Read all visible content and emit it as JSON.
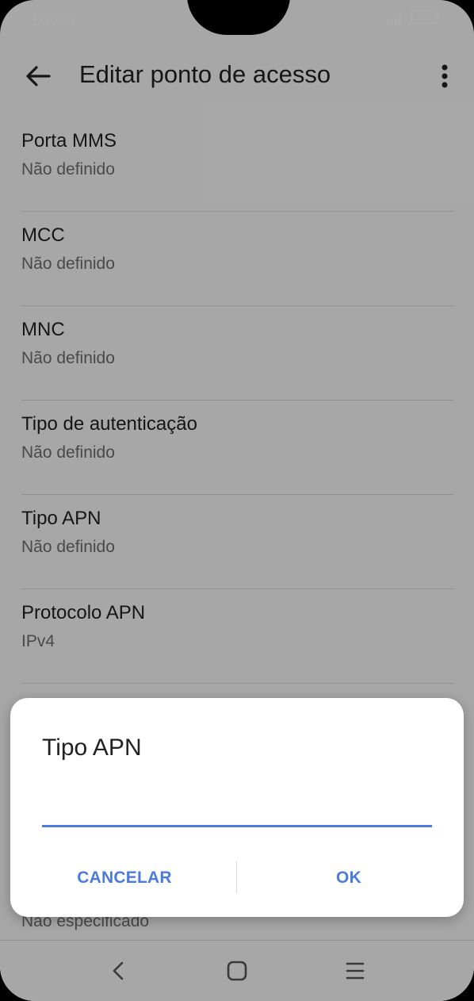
{
  "status_bar": {
    "time": "10:00",
    "battery": "100"
  },
  "app_bar": {
    "title": "Editar ponto de acesso"
  },
  "list": {
    "items": [
      {
        "label": "Porta MMS",
        "value": "Não definido"
      },
      {
        "label": "MCC",
        "value": "Não definido"
      },
      {
        "label": "MNC",
        "value": "Não definido"
      },
      {
        "label": "Tipo de autenticação",
        "value": "Não definido"
      },
      {
        "label": "Tipo APN",
        "value": "Não definido"
      },
      {
        "label": "Protocolo APN",
        "value": "IPv4"
      }
    ],
    "partial_value": "Não especificado"
  },
  "dialog": {
    "title": "Tipo APN",
    "input_value": "",
    "cancel_label": "CANCELAR",
    "ok_label": "OK"
  },
  "colors": {
    "accent": "#4a7be0",
    "scrim": "rgba(0,0,0,0.33)"
  },
  "icons": [
    "signal-icon",
    "battery-icon",
    "back-arrow-icon",
    "more-vert-icon",
    "nav-back-icon",
    "nav-home-icon",
    "nav-menu-icon"
  ]
}
